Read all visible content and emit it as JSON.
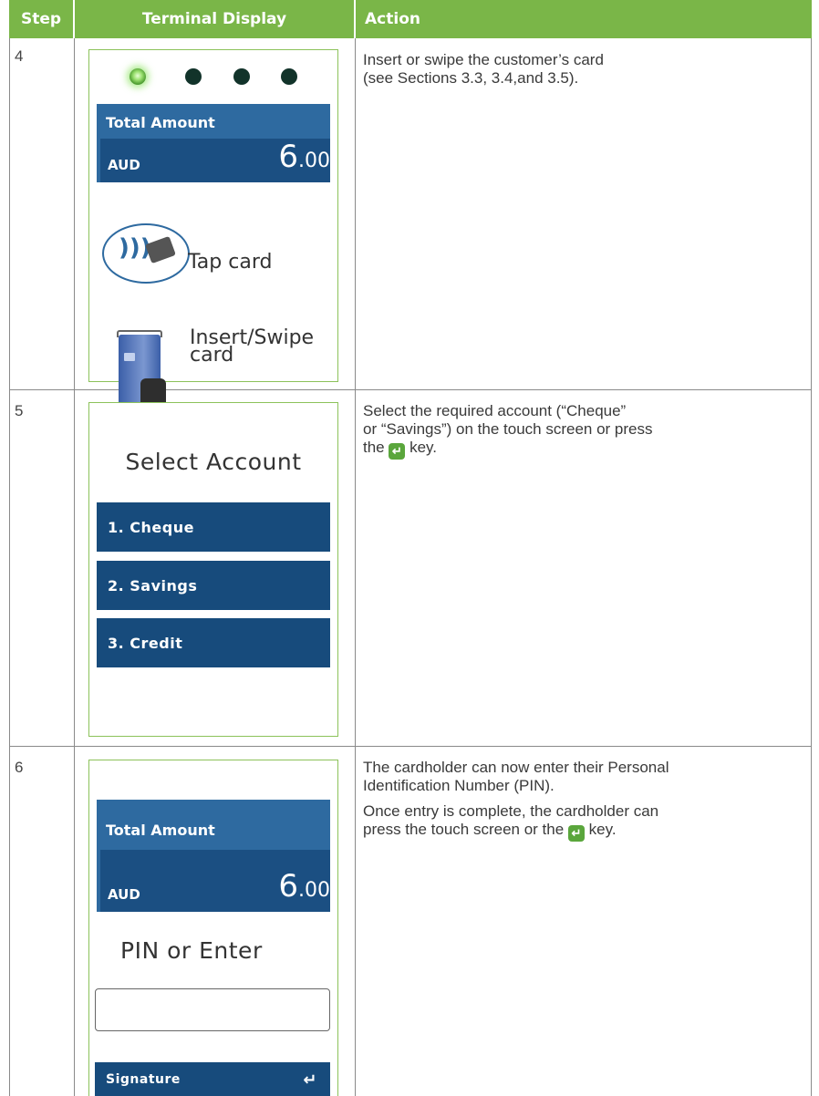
{
  "headers": {
    "step": "Step",
    "display": "Terminal Display",
    "action": "Action"
  },
  "colors": {
    "header_bg": "#7ab648",
    "screen_border": "#8cc25a",
    "panel_bg": "#2e6aa0",
    "button_bg": "#174b7c",
    "key_green": "#5aa63c"
  },
  "rows": [
    {
      "step": "4",
      "screen": {
        "indicator_lights": {
          "count": 4,
          "active": 1
        },
        "total_label": "Total Amount",
        "currency": "AUD",
        "amount_main": "6",
        "amount_cents": ".00",
        "tap_label": "Tap card",
        "insert_label_line1": "Insert/Swipe",
        "insert_label_line2": "card",
        "tap_icon": "contactless-tap-icon",
        "insert_icon": "card-insert-icon"
      },
      "action_line1": "Insert or swipe the customer’s card",
      "action_line2": "(see Sections 3.3, 3.4,and 3.5)."
    },
    {
      "step": "5",
      "screen": {
        "title": "Select Account",
        "options": [
          "1. Cheque",
          "2. Savings",
          "3. Credit"
        ]
      },
      "action_line1": "Select the required account (“Cheque”",
      "action_line2": "or “Savings”) on the touch screen or press",
      "action_line3_pre": "the ",
      "action_line3_post": " key.",
      "key_icon": "enter-key-icon"
    },
    {
      "step": "6",
      "screen": {
        "total_label": "Total Amount",
        "currency": "AUD",
        "amount_main": "6",
        "amount_cents": ".00",
        "prompt": "PIN or Enter",
        "signature_label": "Signature",
        "signature_icon": "enter-arrow-icon"
      },
      "action_p1_line1": "The cardholder can now enter their Personal",
      "action_p1_line2": "Identification Number (PIN).",
      "action_p2_line1": "Once entry is complete, the cardholder can",
      "action_p2_line2_pre": "press the touch screen or the ",
      "action_p2_line2_post": " key.",
      "key_icon": "enter-key-icon"
    }
  ]
}
